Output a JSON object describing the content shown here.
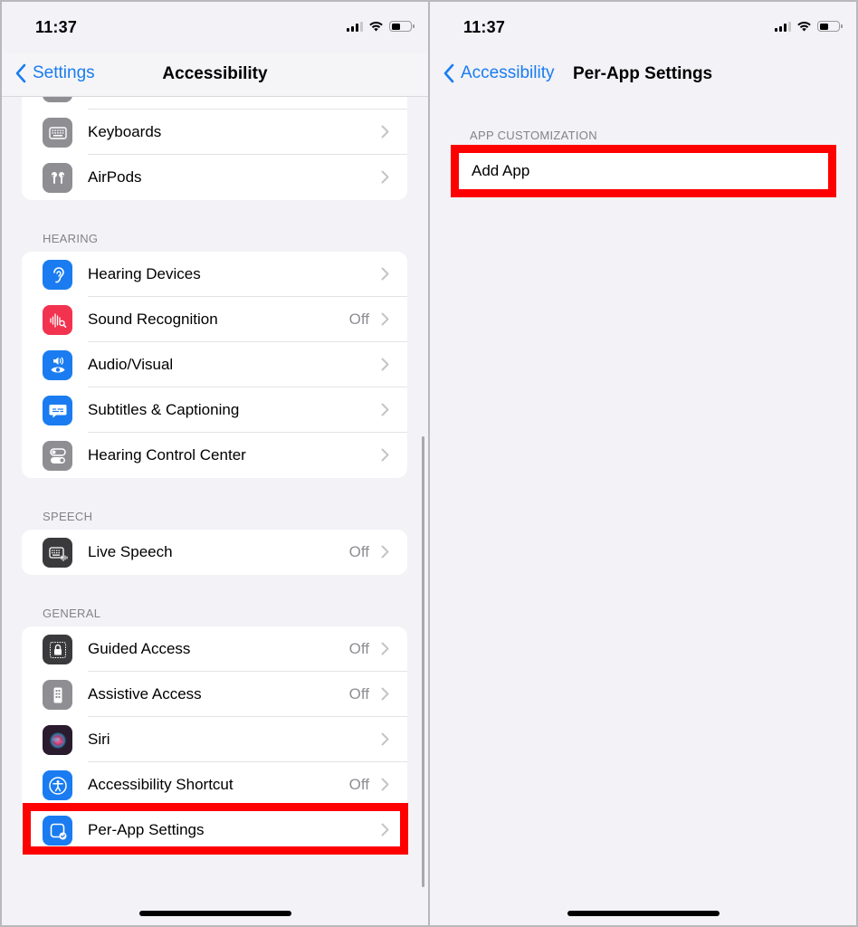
{
  "status_bar": {
    "time": "11:37",
    "signal_icon": "cellular-signal-icon",
    "wifi_icon": "wifi-icon",
    "battery_icon": "battery-icon",
    "battery_level_percent": 45
  },
  "left_screen": {
    "nav": {
      "back_label": "Settings",
      "back_icon": "chevron-left-icon",
      "title": "Accessibility"
    },
    "groups": [
      {
        "header": "",
        "items": [
          {
            "label": "Keyboards",
            "value": "",
            "icon": "keyboard-icon",
            "color": "#8e8e93"
          },
          {
            "label": "AirPods",
            "value": "",
            "icon": "airpods-icon",
            "color": "#8e8e93"
          }
        ]
      },
      {
        "header": "HEARING",
        "items": [
          {
            "label": "Hearing Devices",
            "value": "",
            "icon": "ear-icon",
            "color": "#1a7cf0"
          },
          {
            "label": "Sound Recognition",
            "value": "Off",
            "icon": "sound-waveform-icon",
            "color": "#f2334f"
          },
          {
            "label": "Audio/Visual",
            "value": "",
            "icon": "speaker-eye-icon",
            "color": "#1a7cf0"
          },
          {
            "label": "Subtitles & Captioning",
            "value": "",
            "icon": "captions-bubble-icon",
            "color": "#1a7cf0"
          },
          {
            "label": "Hearing Control Center",
            "value": "",
            "icon": "toggles-icon",
            "color": "#8e8e93"
          }
        ]
      },
      {
        "header": "SPEECH",
        "items": [
          {
            "label": "Live Speech",
            "value": "Off",
            "icon": "keyboard-waveform-icon",
            "color": "#3a3a3c"
          }
        ]
      },
      {
        "header": "GENERAL",
        "items": [
          {
            "label": "Guided Access",
            "value": "Off",
            "icon": "lock-dashed-icon",
            "color": "#3a3a3c"
          },
          {
            "label": "Assistive Access",
            "value": "Off",
            "icon": "assistive-access-icon",
            "color": "#8e8e93"
          },
          {
            "label": "Siri",
            "value": "",
            "icon": "siri-icon",
            "color": "#2b1b2f"
          },
          {
            "label": "Accessibility Shortcut",
            "value": "Off",
            "icon": "accessibility-person-icon",
            "color": "#1a7cf0"
          },
          {
            "label": "Per-App Settings",
            "value": "",
            "icon": "app-checkmark-icon",
            "color": "#1a7cf0"
          }
        ]
      }
    ],
    "highlighted_item": "Per-App Settings"
  },
  "right_screen": {
    "nav": {
      "back_label": "Accessibility",
      "back_icon": "chevron-left-icon",
      "title": "Per-App Settings"
    },
    "section_header": "APP CUSTOMIZATION",
    "add_app_label": "Add App",
    "highlighted_item": "Add App"
  },
  "colors": {
    "accent": "#1a7cf0",
    "highlight": "#ff0000",
    "background": "#f2f2f7",
    "secondary_text": "#8e8e93"
  }
}
